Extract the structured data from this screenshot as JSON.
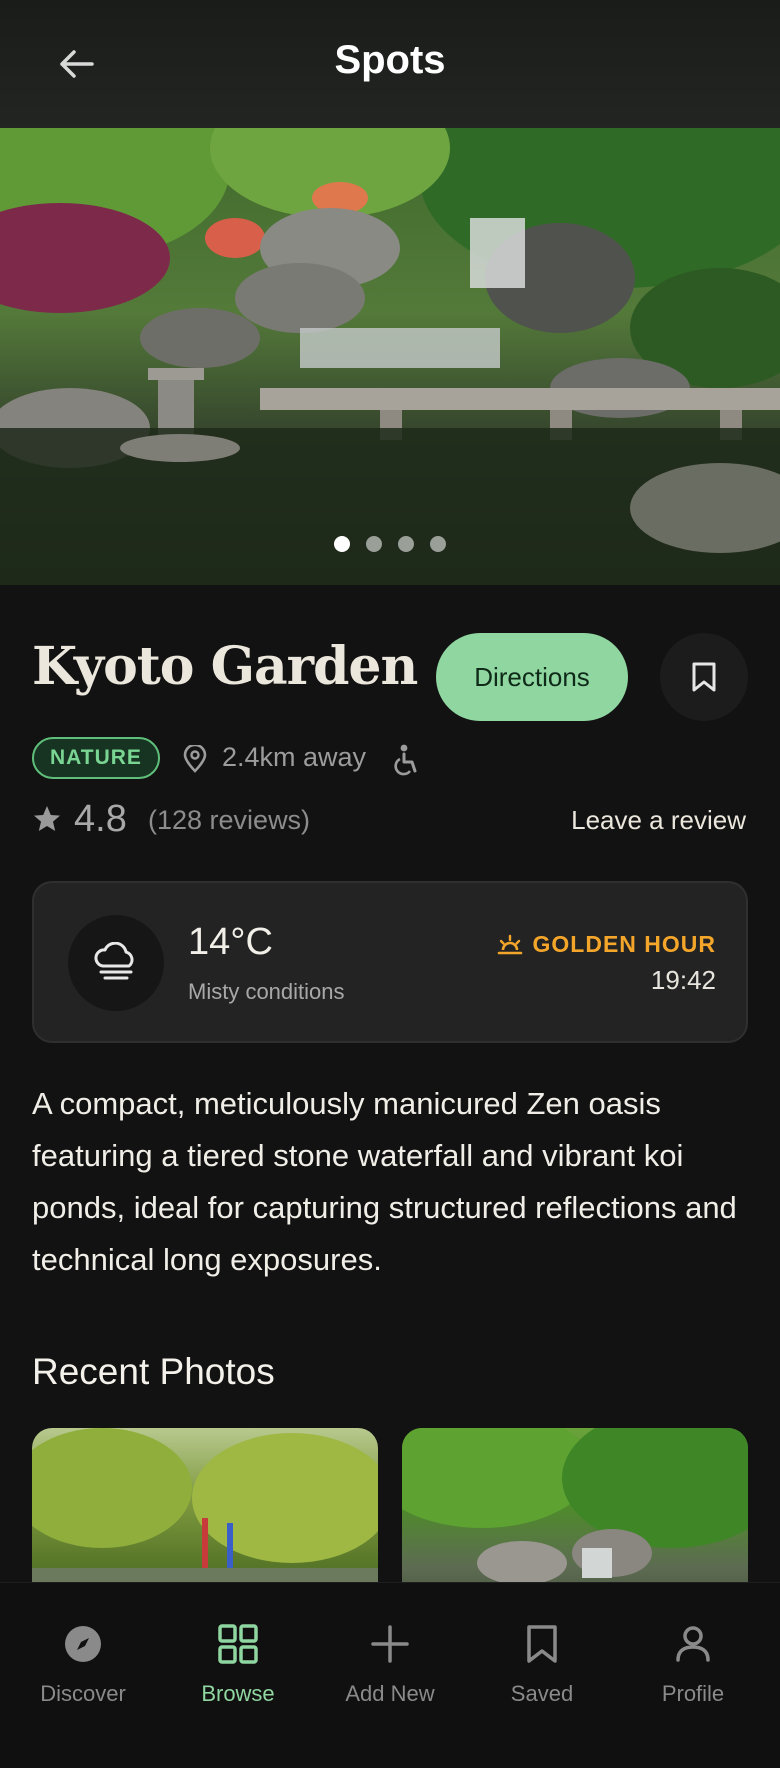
{
  "header": {
    "title": "Spots",
    "back_icon": "arrow-left-icon"
  },
  "hero": {
    "image": "kyoto-garden-waterfall-pond",
    "slides": 4,
    "active_slide": 1
  },
  "spot": {
    "name": "Kyoto Garden",
    "directions_label": "Directions",
    "category": "NATURE",
    "distance": "2.4km away",
    "rating": "4.8",
    "reviews": "(128 reviews)",
    "leave_review": "Leave a review"
  },
  "weather": {
    "temperature": "14°C",
    "conditions": "Misty conditions",
    "golden_hour_label": "GOLDEN HOUR",
    "golden_hour_time": "19:42"
  },
  "description": "A compact, meticulously manicured Zen oasis featuring a tiered stone waterfall and vibrant koi ponds, ideal for capturing structured reflections and technical long exposures.",
  "recent_photos": {
    "title": "Recent Photos"
  },
  "nav": [
    {
      "label": "Discover",
      "icon": "compass-icon",
      "active": false
    },
    {
      "label": "Browse",
      "icon": "grid-icon",
      "active": true
    },
    {
      "label": "Add New",
      "icon": "plus-icon",
      "active": false
    },
    {
      "label": "Saved",
      "icon": "bookmark-icon",
      "active": false
    },
    {
      "label": "Profile",
      "icon": "user-icon",
      "active": false
    }
  ],
  "colors": {
    "accent": "#8fd6a0",
    "golden": "#f4a62a",
    "background": "#121212",
    "card": "#232323"
  }
}
